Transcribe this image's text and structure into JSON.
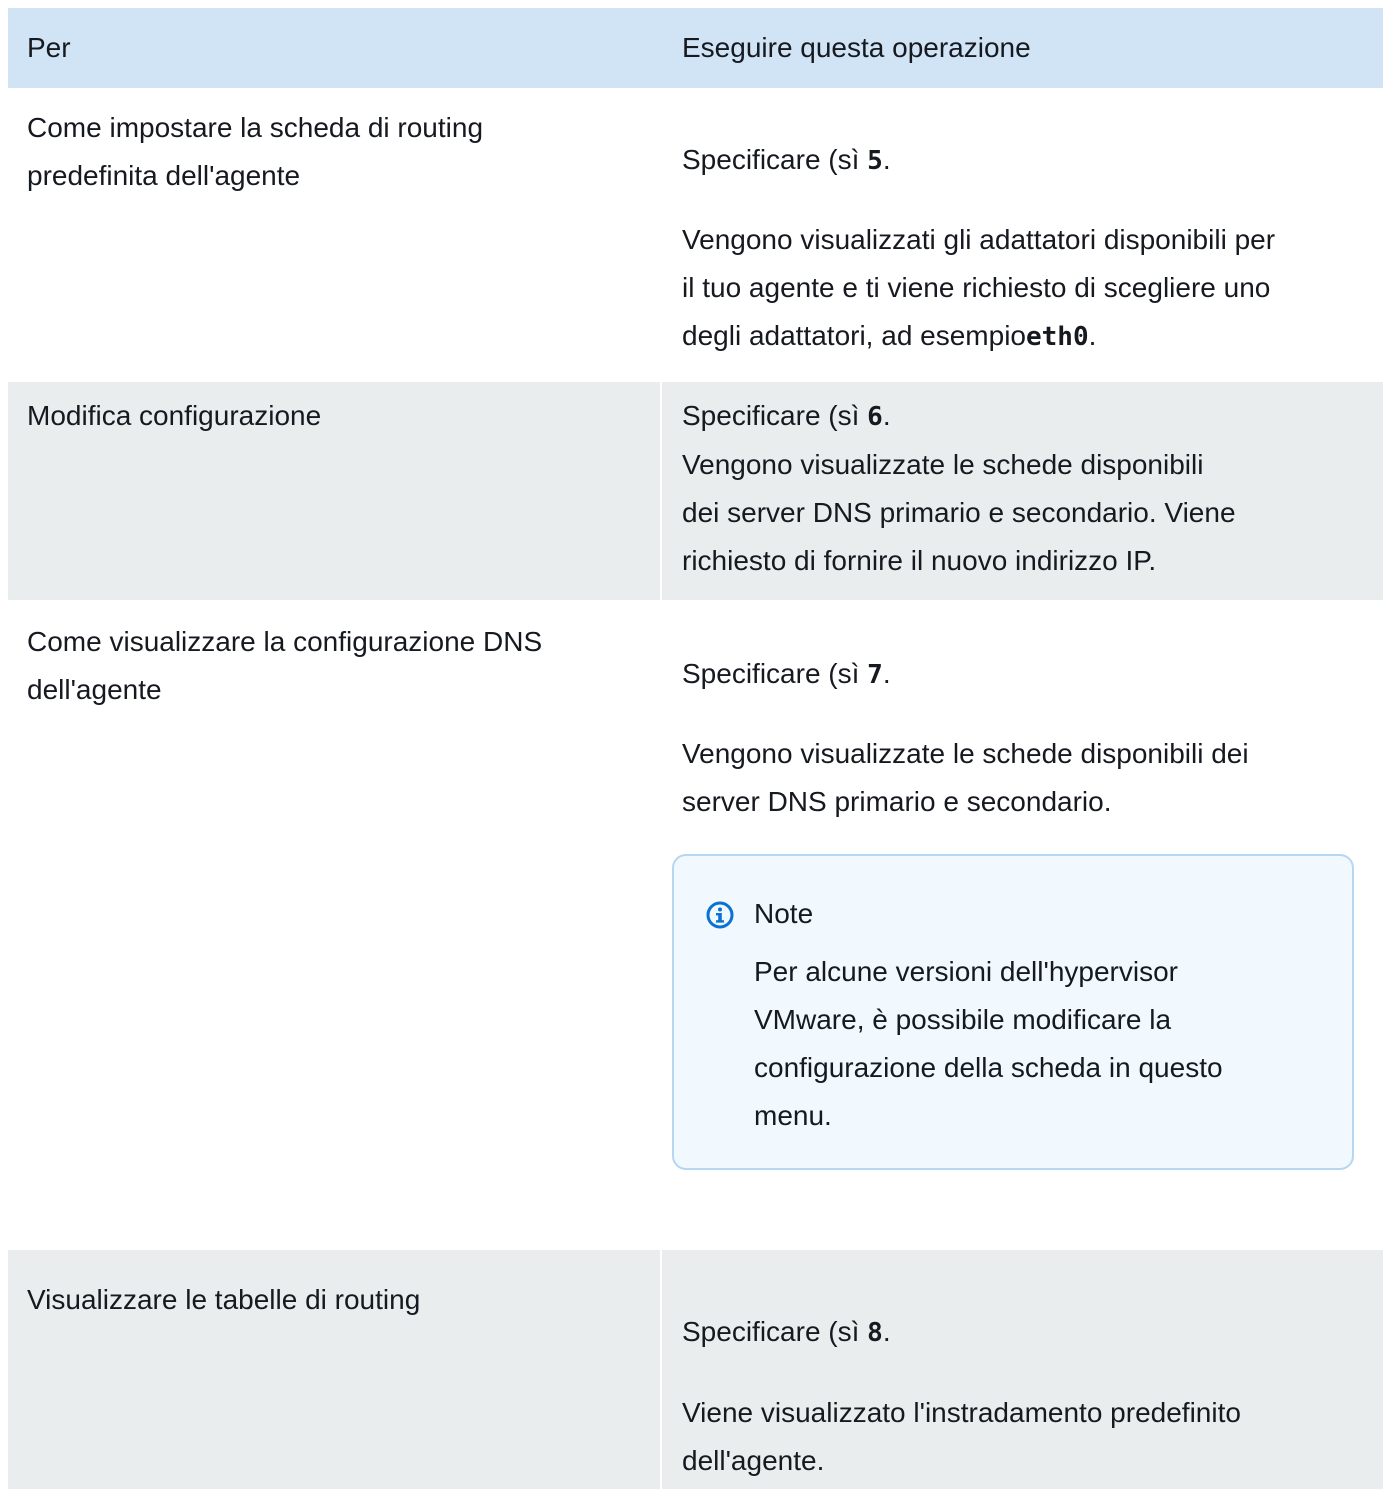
{
  "table": {
    "headers": [
      "Per",
      "Eseguire questa operazione"
    ],
    "rows": [
      {
        "left": [
          "Come impostare la scheda di routing",
          "predefinita dell'agente"
        ],
        "right_action_prefix": "Specificare (sì ",
        "right_action_num": "5",
        "right_action_suffix": ".",
        "right_desc": [
          "Vengono visualizzati gli adattatori disponibili per",
          "il tuo agente e ti viene richiesto di scegliere uno",
          "degli adattatori, ad esempio"
        ],
        "right_code": "eth0",
        "right_code_suffix": "."
      },
      {
        "left": [
          "Modifica configurazione"
        ],
        "right_action_prefix": "Specificare (sì ",
        "right_action_num": "6",
        "right_action_suffix": ".",
        "right_desc": [
          "Vengono visualizzate le schede disponibili",
          "dei server DNS primario e secondario. Viene",
          "richiesto di fornire il nuovo indirizzo IP."
        ]
      },
      {
        "left": [
          "Come visualizzare la configurazione DNS",
          "dell'agente"
        ],
        "right_action_prefix": "Specificare (sì ",
        "right_action_num": "7",
        "right_action_suffix": ".",
        "right_desc": [
          "Vengono visualizzate le schede disponibili dei",
          "server DNS primario e secondario."
        ],
        "note": {
          "title": "Note",
          "body": [
            "Per alcune versioni dell'hypervisor",
            "VMware, è possibile modificare la",
            "configurazione della scheda in questo",
            "menu."
          ]
        }
      },
      {
        "left": [
          "Visualizzare le tabelle di routing"
        ],
        "right_action_prefix": "Specificare (sì ",
        "right_action_num": "8",
        "right_action_suffix": ".",
        "right_desc": [
          "Viene visualizzato l'instradamento predefinito",
          "dell'agente."
        ]
      }
    ]
  },
  "colors": {
    "header_bg": "#d1e4f6",
    "alt_row_bg": "#eaeded",
    "note_bg": "#f1f8fe",
    "note_border": "#b7d6f0",
    "info_icon": "#0972d3"
  },
  "icons": {
    "note_icon": "info-circle-icon"
  }
}
